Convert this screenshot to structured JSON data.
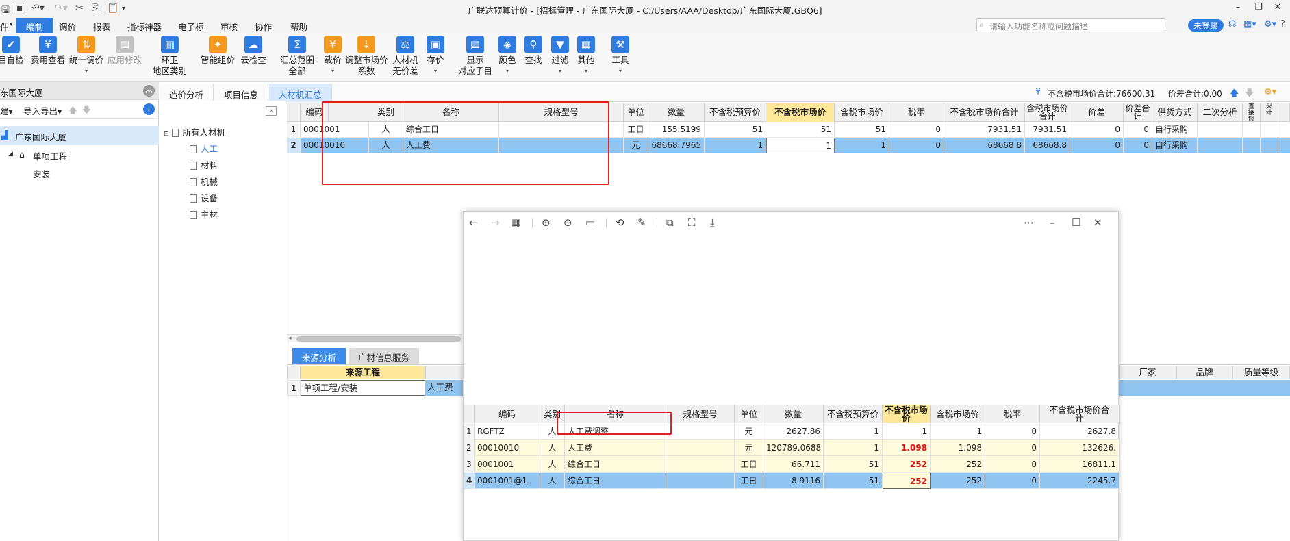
{
  "window": {
    "title": "广联达预算计价 - [招标管理 - 广东国际大厦 - C:/Users/AAA/Desktop/广东国际大厦.GBQ6]"
  },
  "menus": [
    "件",
    "编制",
    "调价",
    "报表",
    "指标神器",
    "电子标",
    "审核",
    "协作",
    "帮助"
  ],
  "search": {
    "placeholder": "请输入功能名称或问题描述"
  },
  "login_label": "未登录",
  "ribbon": [
    {
      "label": "目自检",
      "icon": "check-icon"
    },
    {
      "label": "费用查看",
      "icon": "view-fee-icon"
    },
    {
      "label": "统一调价",
      "icon": "adjust-price-icon"
    },
    {
      "label": "应用修改",
      "icon": "apply-change-icon"
    },
    {
      "label": "环卫\n地区类别",
      "icon": "region-icon"
    },
    {
      "label": "智能组价",
      "icon": "smart-price-icon"
    },
    {
      "label": "云检查",
      "icon": "cloud-check-icon"
    },
    {
      "label": "汇总范围\n全部",
      "icon": "summary-icon"
    },
    {
      "label": "载价",
      "icon": "load-price-icon"
    },
    {
      "label": "调整市场价\n系数",
      "icon": "coefficient-icon"
    },
    {
      "label": "人材机\n无价差",
      "icon": "no-diff-icon"
    },
    {
      "label": "存价",
      "icon": "save-price-icon"
    },
    {
      "label": "显示\n对应子目",
      "icon": "show-item-icon"
    },
    {
      "label": "颜色",
      "icon": "color-icon"
    },
    {
      "label": "查找",
      "icon": "find-icon"
    },
    {
      "label": "过滤",
      "icon": "filter-icon"
    },
    {
      "label": "其他",
      "icon": "other-icon"
    },
    {
      "label": "工具",
      "icon": "tools-icon"
    }
  ],
  "left_panel": {
    "title": "东国际大厦",
    "tools": [
      "建▾",
      "导入导出▾"
    ],
    "tree": [
      "广东国际大厦",
      "单项工程",
      "安装"
    ]
  },
  "category_tree": [
    "所有人材机",
    "人工",
    "材料",
    "机械",
    "设备",
    "主材"
  ],
  "tabs": [
    "造价分析",
    "项目信息",
    "人材机汇总"
  ],
  "totals": {
    "market_total": "不含税市场价合计:76600.31",
    "diff_total": "价差合计:0.00"
  },
  "main_table": {
    "headers": [
      "",
      "编码",
      "类别",
      "名称",
      "规格型号",
      "单位",
      "数量",
      "不含税预算价",
      "不含税市场价",
      "含税市场价",
      "税率",
      "不含税市场价合计",
      "含税市场价\n合计",
      "价差",
      "价差合\n计",
      "供货方式",
      "二次分析",
      "直\n接\n修",
      "采\n计"
    ],
    "rows": [
      [
        "1",
        "0001001",
        "人",
        "综合工日",
        "",
        "工日",
        "155.5199",
        "51",
        "51",
        "51",
        "0",
        "7931.51",
        "7931.51",
        "0",
        "0",
        "自行采购"
      ],
      [
        "2",
        "00010010",
        "人",
        "人工费",
        "",
        "元",
        "68668.7965",
        "1",
        "1",
        "1",
        "0",
        "68668.8",
        "68668.8",
        "0",
        "0",
        "自行采购"
      ]
    ]
  },
  "bottom": {
    "tabs": [
      "来源分析",
      "广材信息服务"
    ],
    "source_header": "来源工程",
    "source_row": [
      "1",
      "单项工程/安装",
      "人工费"
    ],
    "right_headers": [
      "厂家",
      "品牌",
      "质量等级"
    ]
  },
  "image_table": {
    "headers": [
      "",
      "编码",
      "类别",
      "名称",
      "规格型号",
      "单位",
      "数量",
      "不含税预算价",
      "不含税市场\n价",
      "含税市场价",
      "税率",
      "不含税市场价合\n计"
    ],
    "rows": [
      [
        "1",
        "RGFTZ",
        "人",
        "人工费调整",
        "",
        "元",
        "2627.86",
        "1",
        "1",
        "1",
        "0",
        "2627.8"
      ],
      [
        "2",
        "00010010",
        "人",
        "人工费",
        "",
        "元",
        "120789.0688",
        "1",
        "1.098",
        "1.098",
        "0",
        "132626."
      ],
      [
        "3",
        "0001001",
        "人",
        "综合工日",
        "",
        "工日",
        "66.711",
        "51",
        "252",
        "252",
        "0",
        "16811.1"
      ],
      [
        "4",
        "0001001@1",
        "人",
        "综合工日",
        "",
        "工日",
        "8.9116",
        "51",
        "252",
        "252",
        "0",
        "2245.7"
      ]
    ]
  },
  "colors": {
    "accent": "#2f7ce0",
    "selection": "#8fc3f0",
    "highlight_header": "#ffe899",
    "annotation": "#e02020"
  }
}
